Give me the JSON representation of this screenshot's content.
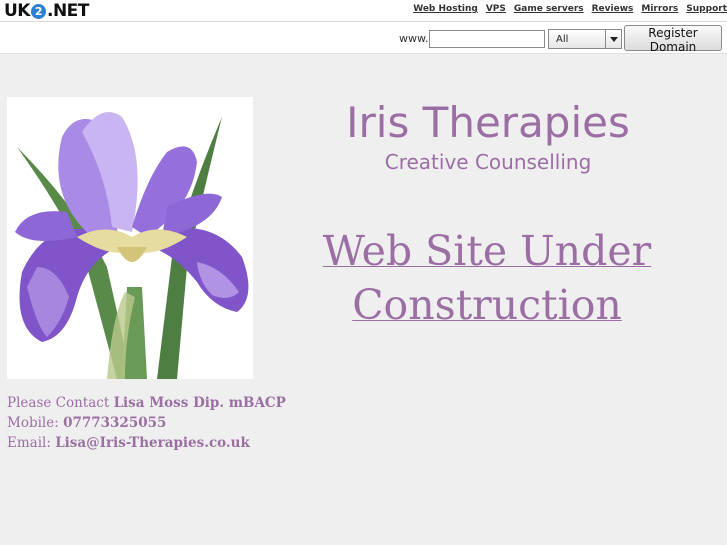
{
  "header": {
    "logo_left": "UK",
    "logo_circle": "2",
    "logo_right": ".NET",
    "nav": [
      "Web Hosting",
      "VPS",
      "Game servers",
      "Reviews",
      "Mirrors",
      "Support"
    ]
  },
  "domain_search": {
    "prefix": "www.",
    "input_value": "",
    "tld_selected": "All",
    "button_label": "Register Domain"
  },
  "site": {
    "title": "Iris Therapies",
    "subtitle": "Creative Counselling",
    "notice_line1": "Web Site Under",
    "notice_line2": "Construction"
  },
  "contact": {
    "line1_label": "Please Contact ",
    "line1_value": "Lisa Moss Dip. mBACP",
    "line2_label": "Mobile: ",
    "line2_value": "07773325055",
    "line3_label": "Email: ",
    "line3_value": "Lisa@Iris-Therapies.co.uk"
  },
  "colors": {
    "accent": "#9b6fa3",
    "background": "#efefef",
    "petal": "#8a5fd0"
  }
}
